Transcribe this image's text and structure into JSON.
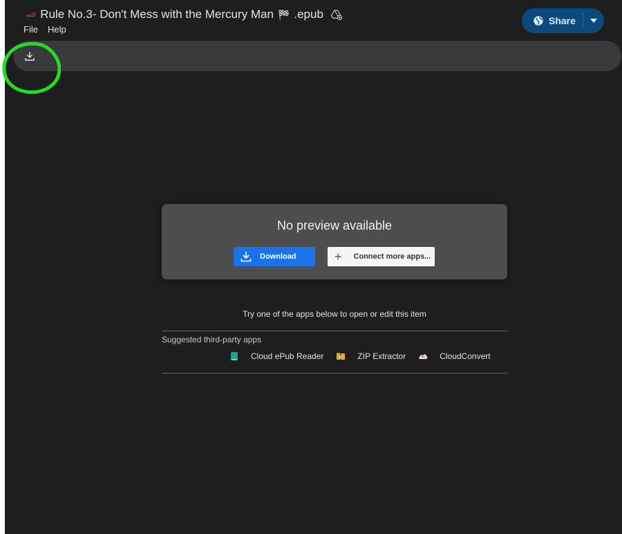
{
  "header": {
    "title": "Rule No.3- Don't Mess with the Mercury Man",
    "title_prefix_icon": "race-car-emoji",
    "title_flag": "🏁",
    "title_suffix": ".epub",
    "drive_icon": "add-to-drive-icon"
  },
  "menu": [
    {
      "label": "File"
    },
    {
      "label": "Help"
    }
  ],
  "share": {
    "label": "Share",
    "icon": "globe-icon",
    "dropdown_icon": "caret-down-icon",
    "color": "#0b4a7a"
  },
  "toolbar": {
    "download_icon": "download-icon"
  },
  "annotation": {
    "color": "#22dd22",
    "shape": "circle"
  },
  "preview_card": {
    "title": "No preview available",
    "download_label": "Download",
    "connect_label": "Connect more apps...",
    "download_color": "#1a73e8"
  },
  "apps_section": {
    "prompt": "Try one of the apps below to open or edit this item",
    "suggested_label": "Suggested third-party apps",
    "apps": [
      {
        "name": "Cloud ePub Reader",
        "icon": "epub-book-icon",
        "color": "#1aa88a"
      },
      {
        "name": "ZIP Extractor",
        "icon": "zip-folder-icon",
        "color": "#e6b820"
      },
      {
        "name": "CloudConvert",
        "icon": "cloud-convert-icon",
        "color": "#d44"
      }
    ]
  }
}
